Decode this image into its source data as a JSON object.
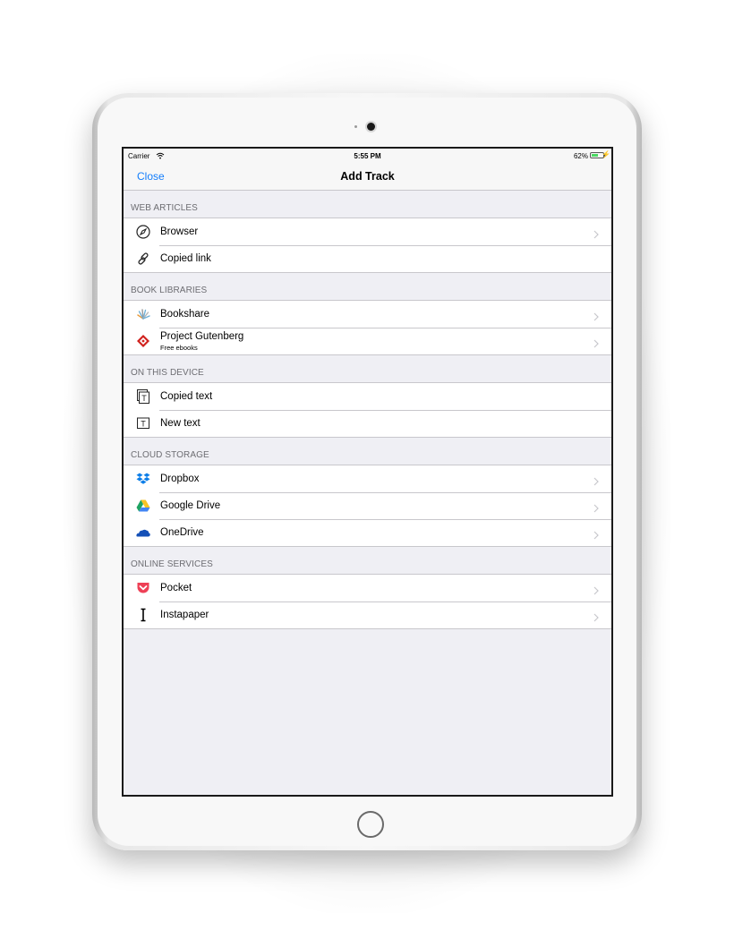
{
  "status_bar": {
    "carrier": "Carrier",
    "time": "5:55 PM",
    "battery": "62%",
    "battery_level": 0.62
  },
  "nav": {
    "left": "Close",
    "title": "Add Track"
  },
  "sections": [
    {
      "header": "WEB ARTICLES",
      "items": [
        {
          "label": "Browser",
          "icon": "compass-icon",
          "chevron": true
        },
        {
          "label": "Copied link",
          "icon": "link-icon",
          "chevron": false
        }
      ]
    },
    {
      "header": "BOOK LIBRARIES",
      "items": [
        {
          "label": "Bookshare",
          "icon": "bookshare-icon",
          "chevron": true
        },
        {
          "label": "Project Gutenberg",
          "subtitle": "Free ebooks",
          "icon": "gutenberg-icon",
          "chevron": true
        }
      ]
    },
    {
      "header": "ON THIS DEVICE",
      "items": [
        {
          "label": "Copied text",
          "icon": "copied-text-icon",
          "chevron": false
        },
        {
          "label": "New text",
          "icon": "new-text-icon",
          "chevron": false
        }
      ]
    },
    {
      "header": "CLOUD STORAGE",
      "items": [
        {
          "label": "Dropbox",
          "icon": "dropbox-icon",
          "chevron": true
        },
        {
          "label": "Google Drive",
          "icon": "google-drive-icon",
          "chevron": true
        },
        {
          "label": "OneDrive",
          "icon": "onedrive-icon",
          "chevron": true
        }
      ]
    },
    {
      "header": "ONLINE SERVICES",
      "items": [
        {
          "label": "Pocket",
          "icon": "pocket-icon",
          "chevron": true
        },
        {
          "label": "Instapaper",
          "icon": "instapaper-icon",
          "chevron": true
        }
      ]
    }
  ],
  "colors": {
    "accent": "#147efb",
    "background": "#efeff4",
    "separator": "#c8c7cc",
    "battery": "#4cd964"
  }
}
